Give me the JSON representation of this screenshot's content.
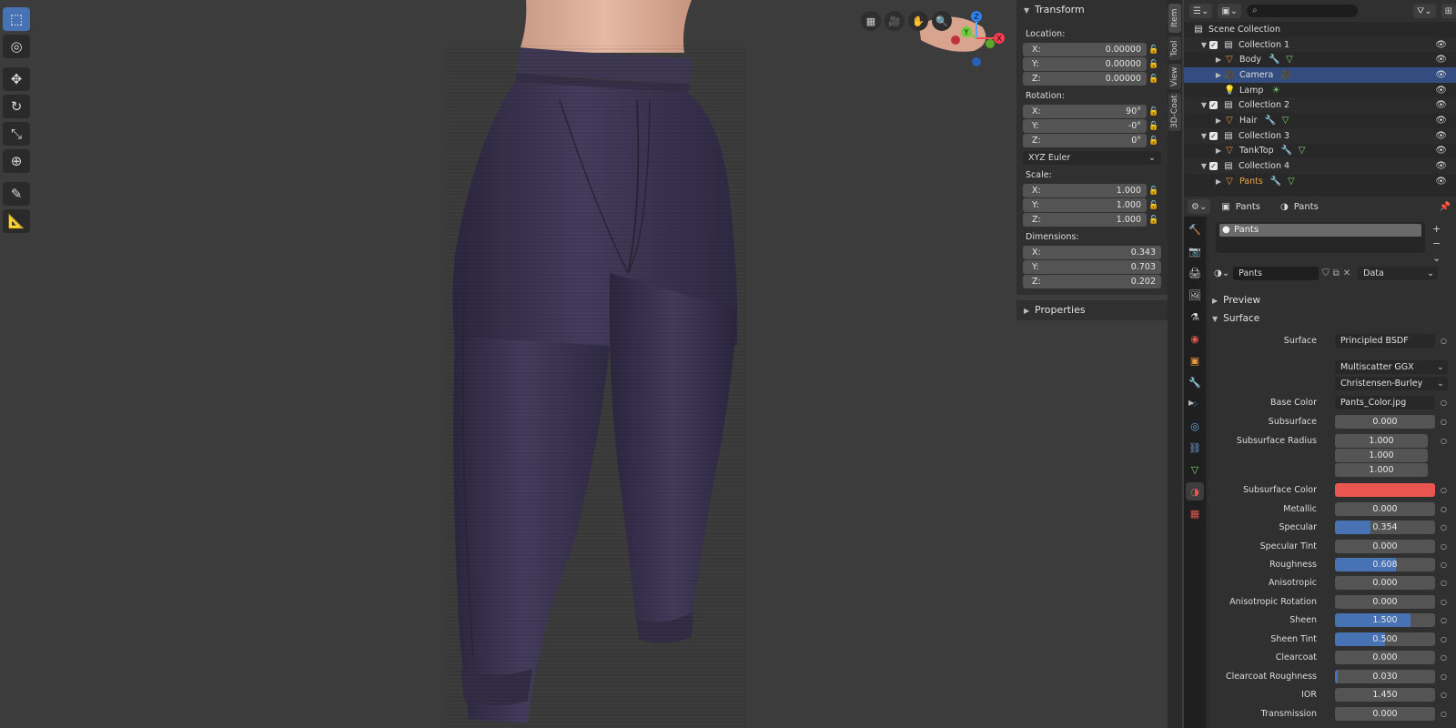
{
  "toolbar": {
    "tools": [
      "select-box-icon",
      "cursor-icon",
      "move-icon",
      "rotate-icon",
      "scale-icon",
      "transform-icon",
      "annotate-icon",
      "measure-icon"
    ]
  },
  "viewport_nav": [
    "grid-icon",
    "camera-icon",
    "hand-icon",
    "zoom-icon"
  ],
  "gizmo": {
    "x": "X",
    "y": "Y",
    "z": "Z"
  },
  "npanel": {
    "transform_title": "Transform",
    "location_label": "Location:",
    "location": [
      {
        "axis": "X:",
        "value": "0.00000"
      },
      {
        "axis": "Y:",
        "value": "0.00000"
      },
      {
        "axis": "Z:",
        "value": "0.00000"
      }
    ],
    "rotation_label": "Rotation:",
    "rotation": [
      {
        "axis": "X:",
        "value": "90°"
      },
      {
        "axis": "Y:",
        "value": "-0°"
      },
      {
        "axis": "Z:",
        "value": "0°"
      }
    ],
    "rotation_mode": "XYZ Euler",
    "scale_label": "Scale:",
    "scale": [
      {
        "axis": "X:",
        "value": "1.000"
      },
      {
        "axis": "Y:",
        "value": "1.000"
      },
      {
        "axis": "Z:",
        "value": "1.000"
      }
    ],
    "dimensions_label": "Dimensions:",
    "dimensions": [
      {
        "axis": "X:",
        "value": "0.343"
      },
      {
        "axis": "Y:",
        "value": "0.703"
      },
      {
        "axis": "Z:",
        "value": "0.202"
      }
    ],
    "properties_title": "Properties"
  },
  "side_tabs": [
    "Item",
    "Tool",
    "View",
    "3D-Coat"
  ],
  "outliner": {
    "scene": "Scene Collection",
    "rows": [
      {
        "label": "Collection 1",
        "kind": "collection"
      },
      {
        "label": "Body",
        "kind": "object"
      },
      {
        "label": "Camera",
        "kind": "camera"
      },
      {
        "label": "Lamp",
        "kind": "lamp"
      },
      {
        "label": "Collection 2",
        "kind": "collection"
      },
      {
        "label": "Hair",
        "kind": "object"
      },
      {
        "label": "Collection 3",
        "kind": "collection"
      },
      {
        "label": "TankTop",
        "kind": "object"
      },
      {
        "label": "Collection 4",
        "kind": "collection"
      },
      {
        "label": "Pants",
        "kind": "object"
      }
    ]
  },
  "properties": {
    "breadcrumb_object": "Pants",
    "breadcrumb_material": "Pants",
    "slot_name": "Pants",
    "material_name": "Pants",
    "link_mode": "Data",
    "preview_label": "Preview",
    "surface_section": "Surface",
    "surface_label": "Surface",
    "surface_shader": "Principled BSDF",
    "distribution": "Multiscatter GGX",
    "subsurface_method": "Christensen-Burley",
    "base_color_label": "Base Color",
    "base_color_texture": "Pants_Color.jpg",
    "subsurface_color_label": "Subsurface Color",
    "subsurface_color": "#e9564f",
    "subsurface_radius_label": "Subsurface Radius",
    "subsurface_radius": [
      "1.000",
      "1.000",
      "1.000"
    ],
    "fields": [
      {
        "label": "Subsurface",
        "value": "0.000",
        "fraction": 0
      },
      {
        "label": "Metallic",
        "value": "0.000",
        "fraction": 0
      },
      {
        "label": "Specular",
        "value": "0.354",
        "fraction": 0.354
      },
      {
        "label": "Specular Tint",
        "value": "0.000",
        "fraction": 0
      },
      {
        "label": "Roughness",
        "value": "0.608",
        "fraction": 0.608
      },
      {
        "label": "Anisotropic",
        "value": "0.000",
        "fraction": 0
      },
      {
        "label": "Anisotropic Rotation",
        "value": "0.000",
        "fraction": 0
      },
      {
        "label": "Sheen",
        "value": "1.500",
        "fraction": 0.75
      },
      {
        "label": "Sheen Tint",
        "value": "0.500",
        "fraction": 0.5
      },
      {
        "label": "Clearcoat",
        "value": "0.000",
        "fraction": 0
      },
      {
        "label": "Clearcoat Roughness",
        "value": "0.030",
        "fraction": 0.03
      },
      {
        "label": "IOR",
        "value": "1.450",
        "fraction": 0
      },
      {
        "label": "Transmission",
        "value": "0.000",
        "fraction": 0
      }
    ]
  },
  "colors": {
    "accent": "#4772b3",
    "selected_row": "#334d80",
    "pants": "#3f3853",
    "skin": "#d9a68f"
  }
}
